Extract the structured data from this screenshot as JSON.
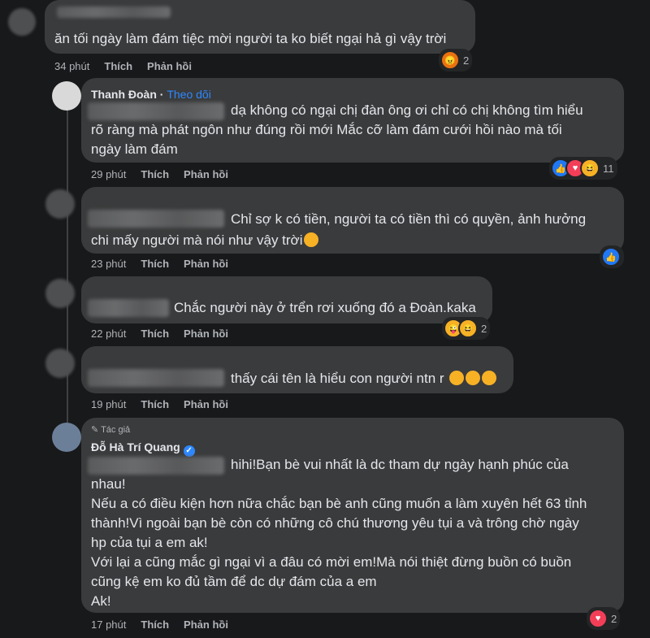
{
  "comments": [
    {
      "text": "ăn tối ngày làm đám tiệc mời người ta ko biết ngại hả gì vậy trời",
      "time": "34 phút",
      "like": "Thích",
      "reply": "Phản hồi",
      "reaction_count": "2"
    },
    {
      "name": "Thanh Đoàn",
      "follow": "Theo dõi",
      "text": "dạ không có ngại chị đàn ông ơi chỉ có chị không tìm hiểu rõ ràng mà phát ngôn như đúng rồi mới Mắc cỡ làm đám cưới hồi nào mà tối ngày làm đám",
      "time": "29 phút",
      "like": "Thích",
      "reply": "Phản hồi",
      "reaction_count": "11"
    },
    {
      "text": "Chỉ sợ k có tiền, người ta có tiền thì có quyền, ảnh hưởng chi mấy người mà nói như vậy trời",
      "time": "23 phút",
      "like": "Thích",
      "reply": "Phản hồi"
    },
    {
      "text": "Chắc người này ở trển rơi xuống đó a Đoàn.kaka",
      "time": "22 phút",
      "like": "Thích",
      "reply": "Phản hồi",
      "reaction_count": "2"
    },
    {
      "text": "thấy cái tên là hiểu con người ntn r",
      "time": "19 phút",
      "like": "Thích",
      "reply": "Phản hồi"
    },
    {
      "author_badge": "Tác giả",
      "name": "Đỗ Hà Trí Quang",
      "text": "hihi!Bạn bè vui nhất là dc tham dự ngày hạnh phúc của nhau!\nNếu a có điều kiện hơn nữa chắc bạn bè anh cũng muốn a làm xuyên hết 63 tỉnh thành!Vì ngoài bạn bè còn có những cô chú thương yêu tụi a và trông chờ ngày hp của tụi a em ak!\nVới lại a cũng mắc gì ngại vì a đâu có mời em!Mà nói thiệt đừng buồn có buồn cũng kệ em ko đủ tầm để dc dự đám của a em\nAk!",
      "time": "17 phút",
      "like": "Thích",
      "reply": "Phản hồi",
      "reaction_count": "2"
    }
  ],
  "c1_line": "ăn tối ngày làm đám tiệc mời người ta ko biết ngại hả gì vậy trời",
  "c2_l1": "dạ không có ngại chị đàn ông ơi chỉ có chị không tìm hiểu",
  "c2_l2": "rõ ràng mà phát ngôn như đúng rồi mới Mắc cỡ làm đám cưới hồi nào mà tối",
  "c2_l3": "ngày làm đám",
  "c3_l1": "Chỉ sợ k có tiền, người ta có tiền thì có quyền, ảnh hưởng",
  "c3_l2": "chi mấy người mà nói như vậy trời",
  "c4_l1": "Chắc người này ở trển rơi xuống đó a Đoàn.kaka",
  "c5_l1": "thấy cái tên là hiểu con người ntn r",
  "c6_l1": "hihi!Bạn bè vui nhất là dc tham dự ngày hạnh phúc của",
  "c6_l2": "nhau!",
  "c6_l3": "Nếu a có điều kiện hơn nữa chắc bạn bè anh cũng muốn a làm xuyên hết 63 tỉnh",
  "c6_l4": "thành!Vì ngoài bạn bè còn có những cô chú thương yêu tụi a và trông chờ ngày",
  "c6_l5": "hp của tụi a em ak!",
  "c6_l6": "Với lại a cũng mắc gì ngại vì a đâu có mời em!Mà nói thiệt đừng buồn có buồn",
  "c6_l7": "cũng kệ em ko đủ tầm để dc dự đám của a em",
  "c6_l8": "Ak!",
  "colors": {
    "background": "#18191a",
    "bubble": "#3a3b3c",
    "link": "#2d88ff"
  }
}
